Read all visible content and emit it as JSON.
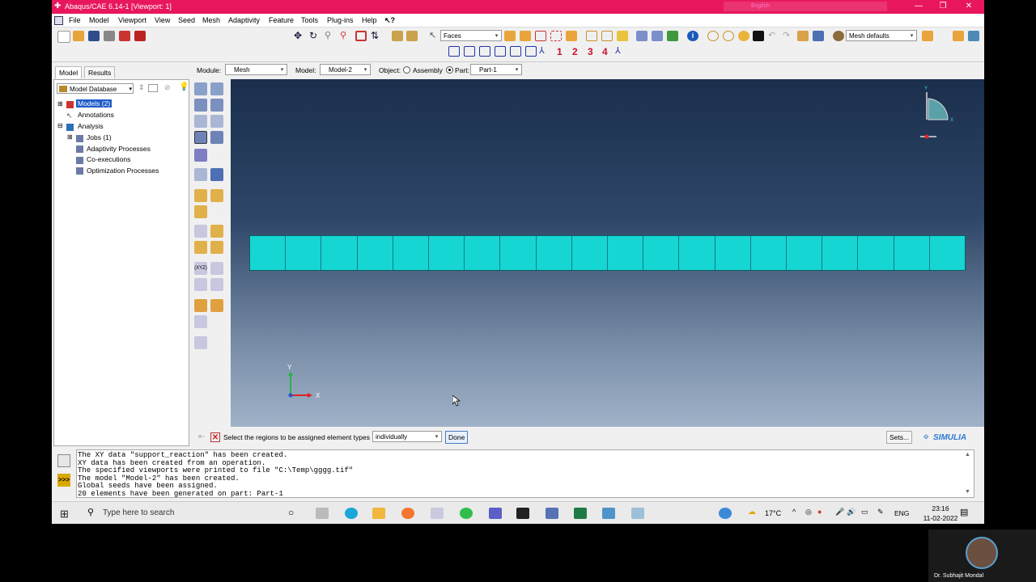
{
  "window": {
    "title": "Abaqus/CAE 6.14-1 [Viewport: 1]",
    "ime": "English",
    "accent": "#e8175d"
  },
  "menu": [
    "File",
    "Model",
    "Viewport",
    "View",
    "Seed",
    "Mesh",
    "Adaptivity",
    "Feature",
    "Tools",
    "Plug-ins",
    "Help"
  ],
  "menu_help_icon": "help-arrow-icon",
  "toolbar": {
    "selection_filter": "Faces",
    "mesh_defaults": "Mesh defaults",
    "view_numbers": [
      "1",
      "2",
      "3",
      "4"
    ]
  },
  "context": {
    "module_label": "Module:",
    "module_value": "Mesh",
    "model_label": "Model:",
    "model_value": "Model-2",
    "object_label": "Object:",
    "assembly_label": "Assembly",
    "part_label": "Part:",
    "part_value": "Part-1"
  },
  "tabs": {
    "model": "Model",
    "results": "Results"
  },
  "tree": {
    "combo": "Model Database",
    "items": [
      "Models (2)",
      "Annotations",
      "Analysis",
      "Jobs (1)",
      "Adaptivity Processes",
      "Co-executions",
      "Optimization Processes"
    ]
  },
  "viewport": {
    "mesh_elements": 20,
    "mesh_color": "#16d6d4",
    "triad_y": "Y",
    "triad_x": "X"
  },
  "prompt": {
    "text": "Select the regions to be assigned element types",
    "dropdown": "individually",
    "done": "Done",
    "sets": "Sets...",
    "brand": "SIMULIA"
  },
  "messages": [
    "The XY data \"support_reaction\" has been created.",
    "XY data has been created from an operation.",
    "The specified viewports were printed to file \"C:\\Temp\\gggg.tif\"",
    "The model \"Model-2\" has been created.",
    "Global seeds have been assigned.",
    "20 elements have been generated on part: Part-1"
  ],
  "taskbar": {
    "search": "Type here to search",
    "temp": "17°C",
    "lang": "ENG",
    "time": "23:16",
    "date": "11-02-2022"
  },
  "webcam": {
    "name": "Dr. Subhajit Mondal"
  }
}
